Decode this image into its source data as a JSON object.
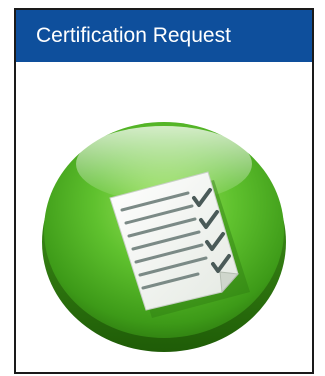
{
  "card": {
    "title": "Certification Request",
    "icon": "checklist-document-icon",
    "header_color": "#0e4f9c",
    "button_color": "#5fc12e"
  }
}
